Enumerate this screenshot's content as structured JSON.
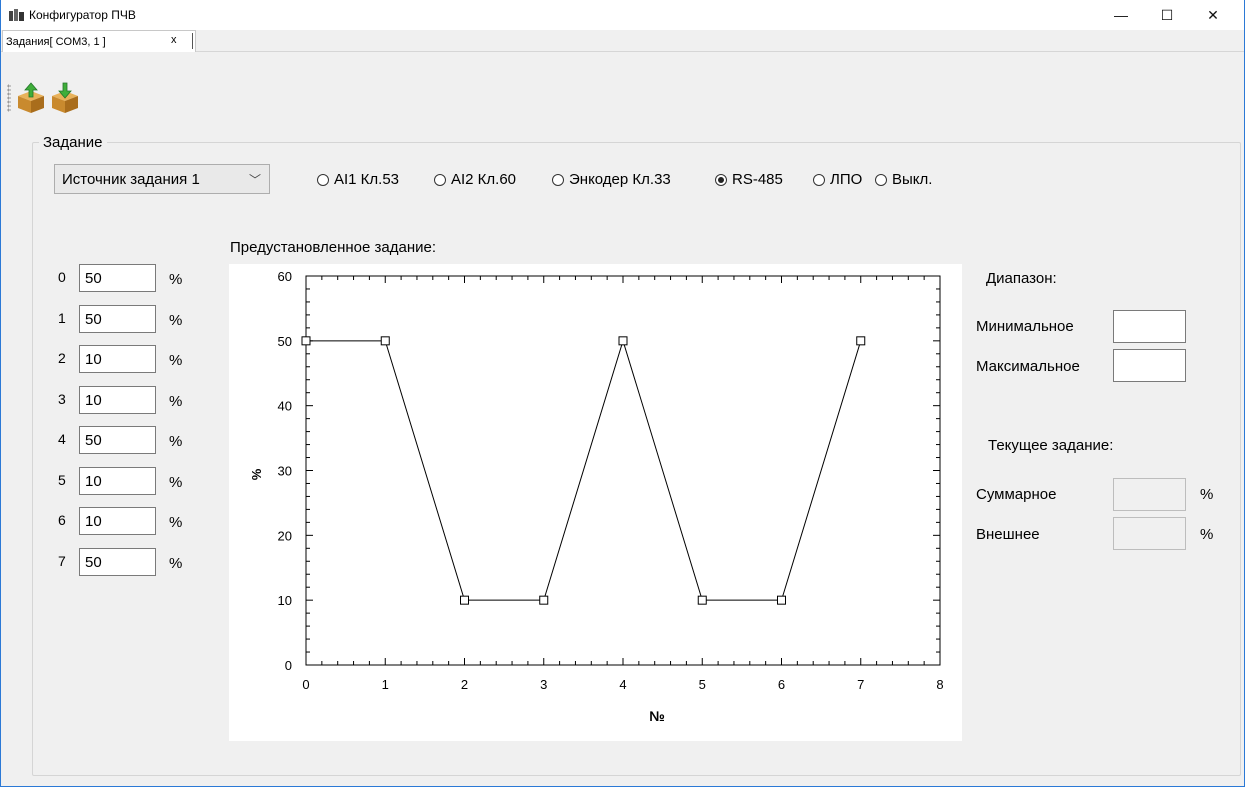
{
  "window": {
    "title": "Конфигуратор ПЧВ",
    "minimize": "—",
    "maximize": "☐",
    "close": "✕"
  },
  "tab": {
    "label": "Задания[ COM3, 1 ]",
    "close": "x"
  },
  "toolbar": {
    "icons": [
      "upload-box-icon",
      "download-box-icon"
    ]
  },
  "group": {
    "title": "Задание",
    "source_select": "Источник задания 1",
    "radios": [
      {
        "label": "AI1 Кл.53",
        "checked": false
      },
      {
        "label": "AI2 Кл.60",
        "checked": false
      },
      {
        "label": "Энкодер Кл.33",
        "checked": false
      },
      {
        "label": "RS-485",
        "checked": true
      },
      {
        "label": "ЛПО",
        "checked": false
      },
      {
        "label": "Выкл.",
        "checked": false
      }
    ]
  },
  "presets": {
    "unit": "%",
    "items": [
      {
        "index": "0",
        "value": "50"
      },
      {
        "index": "1",
        "value": "50"
      },
      {
        "index": "2",
        "value": "10"
      },
      {
        "index": "3",
        "value": "10"
      },
      {
        "index": "4",
        "value": "50"
      },
      {
        "index": "5",
        "value": "10"
      },
      {
        "index": "6",
        "value": "10"
      },
      {
        "index": "7",
        "value": "50"
      }
    ]
  },
  "range": {
    "title": "Диапазон:",
    "min_label": "Минимальное",
    "max_label": "Максимальное",
    "min_value": "",
    "max_value": ""
  },
  "current": {
    "title": "Текущее задание:",
    "total_label": "Суммарное",
    "external_label": "Внешнее",
    "unit": "%"
  },
  "chart_data": {
    "type": "line",
    "title": "Предустановленное задание:",
    "xlabel": "№",
    "ylabel": "%",
    "x": [
      0,
      1,
      2,
      3,
      4,
      5,
      6,
      7
    ],
    "series": [
      {
        "values": [
          50,
          50,
          10,
          10,
          50,
          10,
          10,
          50
        ]
      }
    ],
    "xlim": [
      0,
      8
    ],
    "ylim": [
      0,
      60
    ],
    "xticks": [
      0,
      1,
      2,
      3,
      4,
      5,
      6,
      7,
      8
    ],
    "yticks": [
      0,
      10,
      20,
      30,
      40,
      50,
      60
    ],
    "grid": false,
    "marker": "square"
  }
}
